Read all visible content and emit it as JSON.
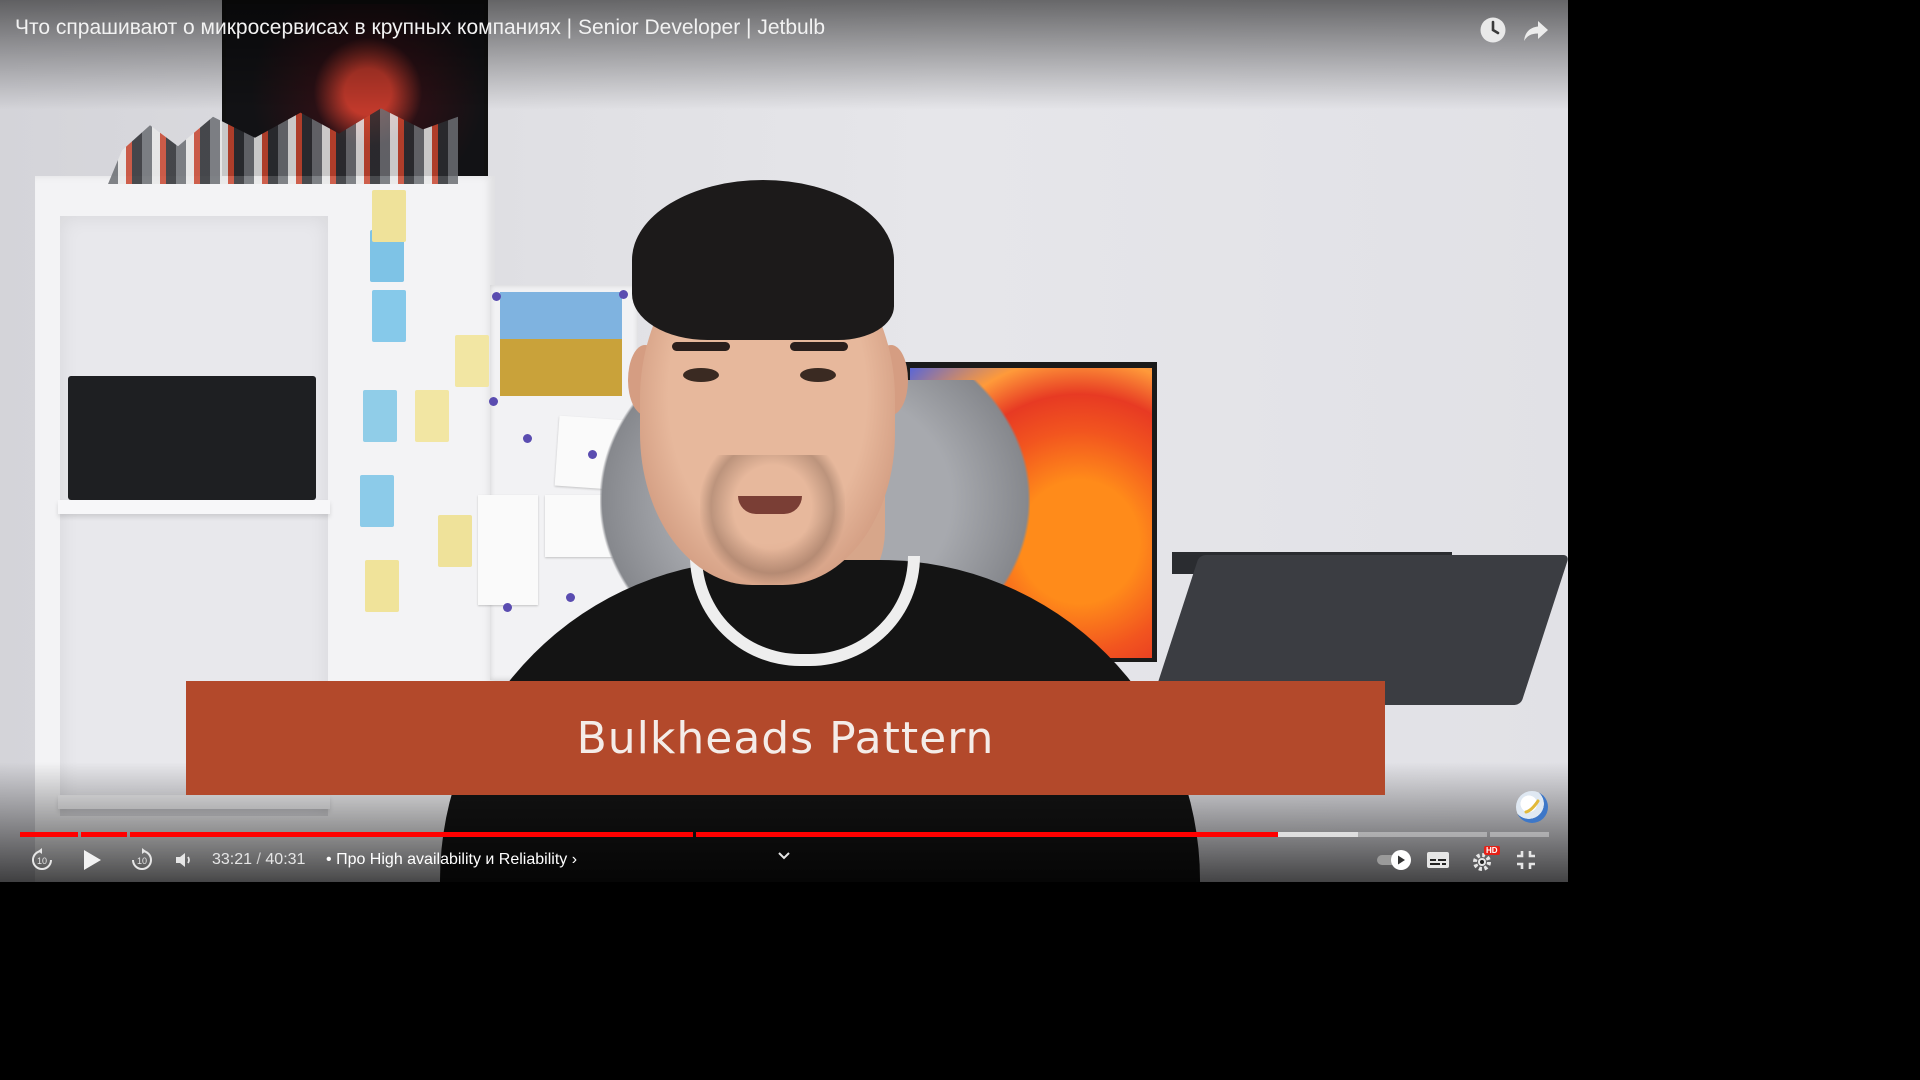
{
  "video": {
    "title": "Что спрашивают о микросервисах в крупных компаниях | Senior Developer | Jetbulb",
    "caption_overlay": "Bulkheads Pattern"
  },
  "top_controls": {
    "watch_later_icon": "clock-icon",
    "share_icon": "share-arrow-icon"
  },
  "player": {
    "current_time": "33:21",
    "time_separator": " / ",
    "duration": "40:31",
    "chapter_prefix": "•",
    "chapter_title": "Про High availability и Reliability",
    "chapter_arrow": "›",
    "progress_fraction": 0.823,
    "buffered_fraction": 0.875,
    "autoplay_on": true,
    "quality_badge": "HD",
    "accent_color": "#ff0000"
  },
  "icons": {
    "rewind": "rewind-10-icon",
    "play": "play-icon",
    "forward": "forward-10-icon",
    "volume": "volume-icon",
    "expand": "chevron-down-icon",
    "autoplay": "autoplay-toggle",
    "subtitles": "subtitles-icon",
    "settings": "gear-icon",
    "exit_fullscreen": "exit-fullscreen-icon"
  }
}
